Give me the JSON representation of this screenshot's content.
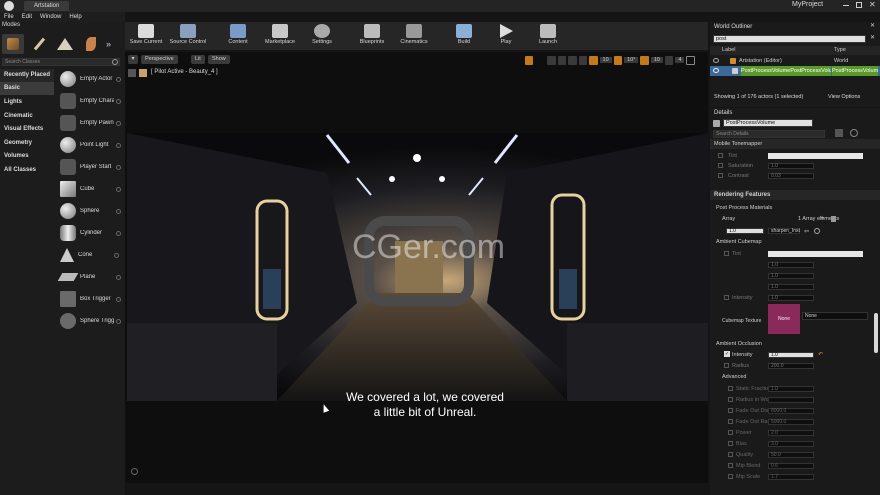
{
  "window": {
    "tab_title": "Artstation",
    "project": "MyProject"
  },
  "menu": [
    "File",
    "Edit",
    "Window",
    "Help"
  ],
  "modes": {
    "title": "Modes",
    "search_placeholder": "Search Classes",
    "categories": [
      "Recently Placed",
      "Basic",
      "Lights",
      "Cinematic",
      "Visual Effects",
      "Geometry",
      "Volumes",
      "All Classes"
    ],
    "items": [
      "Empty Actor",
      "Empty Character",
      "Empty Pawn",
      "Point Light",
      "Player Start",
      "Cube",
      "Sphere",
      "Cylinder",
      "Cone",
      "Plane",
      "Box Trigger",
      "Sphere Trigger"
    ]
  },
  "toolbar": [
    "Save Current",
    "Source Control",
    "Content",
    "Marketplace",
    "Settings",
    "Blueprints",
    "Cinematics",
    "Build",
    "Play",
    "Launch"
  ],
  "viewport": {
    "perspective": "Perspective",
    "lit": "Lit",
    "show": "Show",
    "pilot": "[ Pilot Active - Beauty_4 ]",
    "grid_values": [
      "10",
      "10°",
      "10",
      "4"
    ],
    "watermark": "CGer.com",
    "subtitle_line1": "We covered a lot, we covered",
    "subtitle_line2": "a little bit of Unreal."
  },
  "outliner": {
    "title": "World Outliner",
    "search_value": "post",
    "col_label": "Label",
    "col_type": "Type",
    "rows": [
      {
        "label": "Artstation (Editor)",
        "type": "World"
      },
      {
        "label": "PostProcessVolumePostProcessVolume",
        "type": "PostProcessVolume"
      }
    ],
    "status": "Showing 1 of 176 actors (1 selected)",
    "view_options": "View Options"
  },
  "details": {
    "title": "Details",
    "object_name": "PostProcessVolume",
    "search_placeholder": "Search Details",
    "section_mobile": "Mobile Tonemapper",
    "mobile_rows": [
      {
        "label": "Tint",
        "value": ""
      },
      {
        "label": "Saturation",
        "value": "1.0"
      },
      {
        "label": "Contrast",
        "value": "0.03"
      }
    ],
    "section_rendering": "Rendering Features",
    "post_process_materials": "Post Process Materials",
    "array_label": "Array",
    "array_value": "1 Array elements",
    "element_value": "1.0",
    "element_asset": "sharpen_Inst",
    "ambient_cubemap": "Ambient Cubemap",
    "cubemap_rows": [
      {
        "label": "Tint",
        "value": ""
      },
      {
        "label": "",
        "value": "1.0"
      },
      {
        "label": "",
        "value": "1.0"
      },
      {
        "label": "",
        "value": "1.0"
      },
      {
        "label": "Intensity",
        "value": "1.0"
      }
    ],
    "cubemap_texture": "Cubemap Texture",
    "cubemap_thumb": "None",
    "cubemap_select": "None",
    "ambient_occlusion": "Ambient Occlusion",
    "ao_intensity_label": "Intensity",
    "ao_intensity_value": "1.0",
    "ao_radius_label": "Radius",
    "ao_radius_value": "200.0",
    "advanced": "Advanced",
    "advanced_rows": [
      {
        "label": "Static Fraction",
        "value": "1.0"
      },
      {
        "label": "Radius in World",
        "value": ""
      },
      {
        "label": "Fade Out Distance",
        "value": "8000.0"
      },
      {
        "label": "Fade Out Radius",
        "value": "5000.0"
      },
      {
        "label": "Power",
        "value": "2.0"
      },
      {
        "label": "Bias",
        "value": "3.0"
      },
      {
        "label": "Quality",
        "value": "50.0"
      },
      {
        "label": "Mip Blend",
        "value": "0.6"
      },
      {
        "label": "Mip Scale",
        "value": "1.7"
      }
    ]
  },
  "colors": {
    "accent": "#c47a1a",
    "selection": "#3a6a9a",
    "highlight_green": "#5a9a2a",
    "panel": "#1a1a1a"
  }
}
